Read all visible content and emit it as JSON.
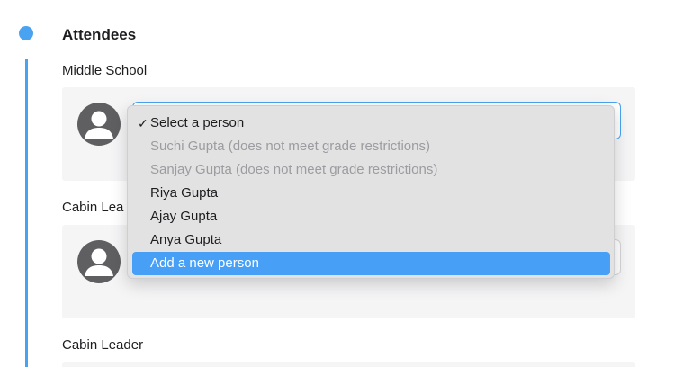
{
  "section": {
    "title": "Attendees"
  },
  "groups": [
    {
      "label": "Middle School"
    },
    {
      "label": "Cabin Lea"
    },
    {
      "label": "Cabin Leader"
    }
  ],
  "dropdown": {
    "check_mark": "✓",
    "items": [
      {
        "label": "Select a person",
        "selected": true,
        "disabled": false
      },
      {
        "label": "Suchi Gupta (does not meet grade restrictions)",
        "disabled": true
      },
      {
        "label": "Sanjay Gupta (does not meet grade restrictions)",
        "disabled": true
      },
      {
        "label": "Riya Gupta",
        "disabled": false
      },
      {
        "label": "Ajay Gupta",
        "disabled": false
      },
      {
        "label": "Anya Gupta",
        "disabled": false
      },
      {
        "label": "Add a new person",
        "highlighted": true,
        "disabled": false
      }
    ]
  },
  "colors": {
    "accent": "#4aa3f0",
    "highlight": "#47a0f5",
    "disabled_text": "#9c9ca0",
    "card_bg": "#f5f5f6",
    "avatar": "#5f5f61"
  }
}
